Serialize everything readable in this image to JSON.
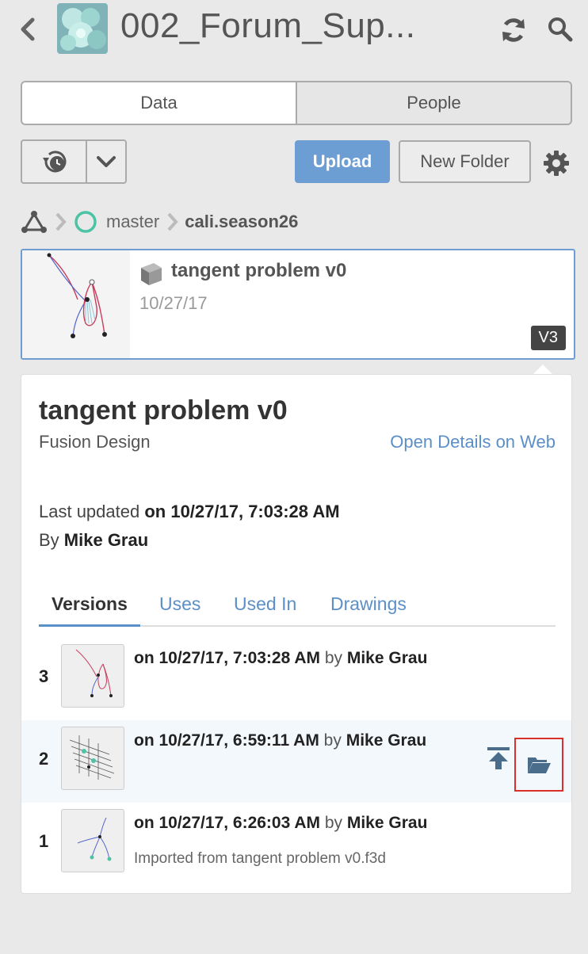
{
  "header": {
    "title": "002_Forum_Sup...",
    "back_icon": "chevron-left-icon",
    "refresh_icon": "refresh-icon",
    "search_icon": "search-icon"
  },
  "tabs_main": {
    "data_label": "Data",
    "people_label": "People"
  },
  "toolbar": {
    "upload_label": "Upload",
    "new_folder_label": "New Folder"
  },
  "breadcrumb": {
    "branch": "master",
    "folder": "cali.season26"
  },
  "selected_item": {
    "name": "tangent problem v0",
    "date": "10/27/17",
    "version_badge": "V3"
  },
  "details": {
    "title": "tangent problem v0",
    "type": "Fusion Design",
    "open_link": "Open Details on Web",
    "last_updated_prefix": "Last updated ",
    "last_updated_value": "on 10/27/17, 7:03:28 AM",
    "by_prefix": "By ",
    "by_value": "Mike Grau",
    "tabs": [
      "Versions",
      "Uses",
      "Used In",
      "Drawings"
    ]
  },
  "versions": [
    {
      "num": "3",
      "when": "on 10/27/17, 7:03:28 AM",
      "by_word": " by ",
      "author": "Mike Grau",
      "note": ""
    },
    {
      "num": "2",
      "when": "on 10/27/17, 6:59:11 AM",
      "by_word": " by ",
      "author": "Mike Grau",
      "note": ""
    },
    {
      "num": "1",
      "when": "on 10/27/17, 6:26:03 AM",
      "by_word": " by ",
      "author": "Mike Grau",
      "note": "Imported from tangent problem v0.f3d"
    }
  ],
  "colors": {
    "accent": "#6d9ed3",
    "link": "#5b8fc7",
    "highlight_box": "#d9302c",
    "branch_circle": "#4cc3a5"
  }
}
